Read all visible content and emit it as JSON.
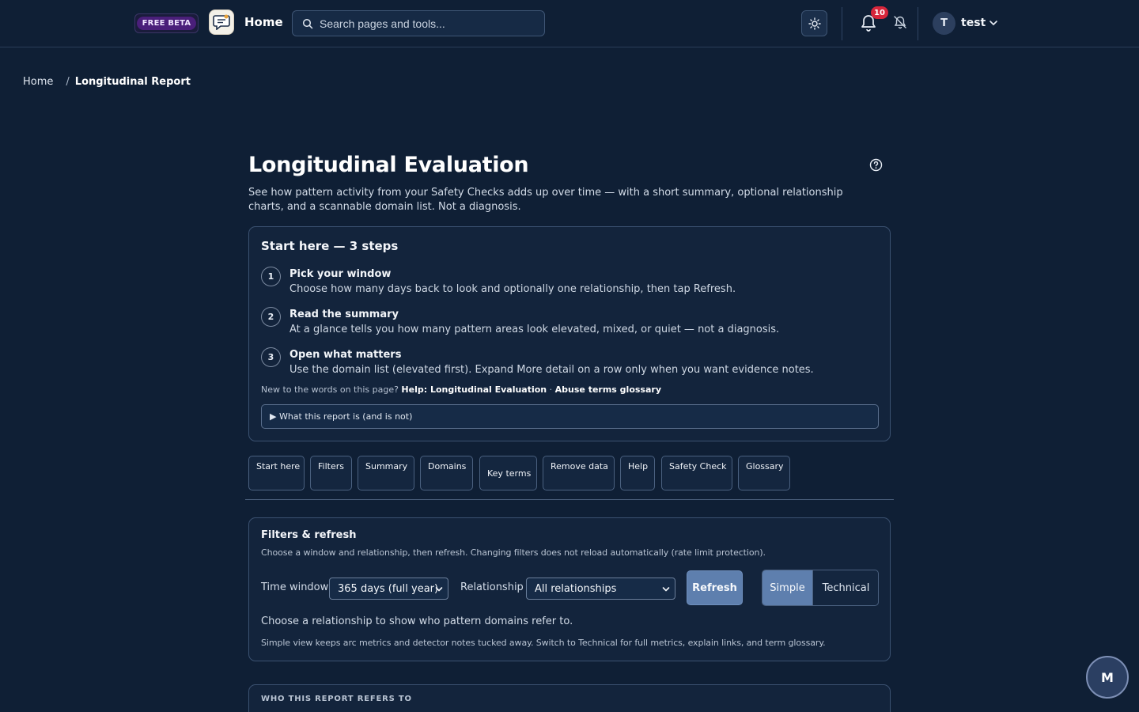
{
  "header": {
    "beta_label": "FREE BETA",
    "home_label": "Home",
    "search_placeholder": "Search pages and tools...",
    "notification_count": "10",
    "user_initial": "T",
    "user_name": "test"
  },
  "breadcrumb": {
    "home": "Home",
    "separator": "/",
    "current": "Longitudinal Report"
  },
  "main": {
    "title": "Longitudinal Evaluation",
    "description": "See how pattern activity from your Safety Checks adds up over time — with a short summary, optional relationship charts, and a scannable domain list. Not a diagnosis."
  },
  "start_here": {
    "title": "Start here — 3 steps",
    "steps": [
      {
        "num": "1",
        "title": "Pick your window",
        "text": "Choose how many days back to look and optionally one relationship, then tap Refresh."
      },
      {
        "num": "2",
        "title": "Read the summary",
        "text": "At a glance tells you how many pattern areas look elevated, mixed, or quiet — not a diagnosis."
      },
      {
        "num": "3",
        "title": "Open what matters",
        "text": "Use the domain list (elevated first). Expand More detail on a row only when you want evidence notes."
      }
    ],
    "new_words_prefix": "New to the words on this page?",
    "help_link": "Help: Longitudinal Evaluation",
    "link_sep": "·",
    "glossary_link": "Abuse terms glossary",
    "details_label": "▶ What this report is (and is not)"
  },
  "tabs": [
    "Start here",
    "Filters",
    "Summary",
    "Domains",
    "Key terms",
    "Remove data",
    "Help",
    "Safety Check",
    "Glossary"
  ],
  "filters": {
    "title": "Filters & refresh",
    "subtitle": "Choose a window and relationship, then refresh. Changing filters does not reload automatically (rate limit protection).",
    "time_window_label": "Time window",
    "time_window_value": "365 days (full year)",
    "relationship_label": "Relationship",
    "relationship_value": "All relationships",
    "refresh_label": "Refresh",
    "view_simple": "Simple",
    "view_technical": "Technical",
    "selected_view": "Simple",
    "hint": "Choose a relationship to show who pattern domains refer to.",
    "note": "Simple view keeps arc metrics and detector notes tucked away. Switch to Technical for full metrics, explain links, and term glossary."
  },
  "who_card": {
    "label": "WHO THIS REPORT REFERS TO"
  },
  "fab": {
    "label": "M"
  },
  "colors": {
    "background": "#0f1f35",
    "accent": "#5e7fae",
    "badge": "#d6263b",
    "beta": "#4a1f7a"
  }
}
